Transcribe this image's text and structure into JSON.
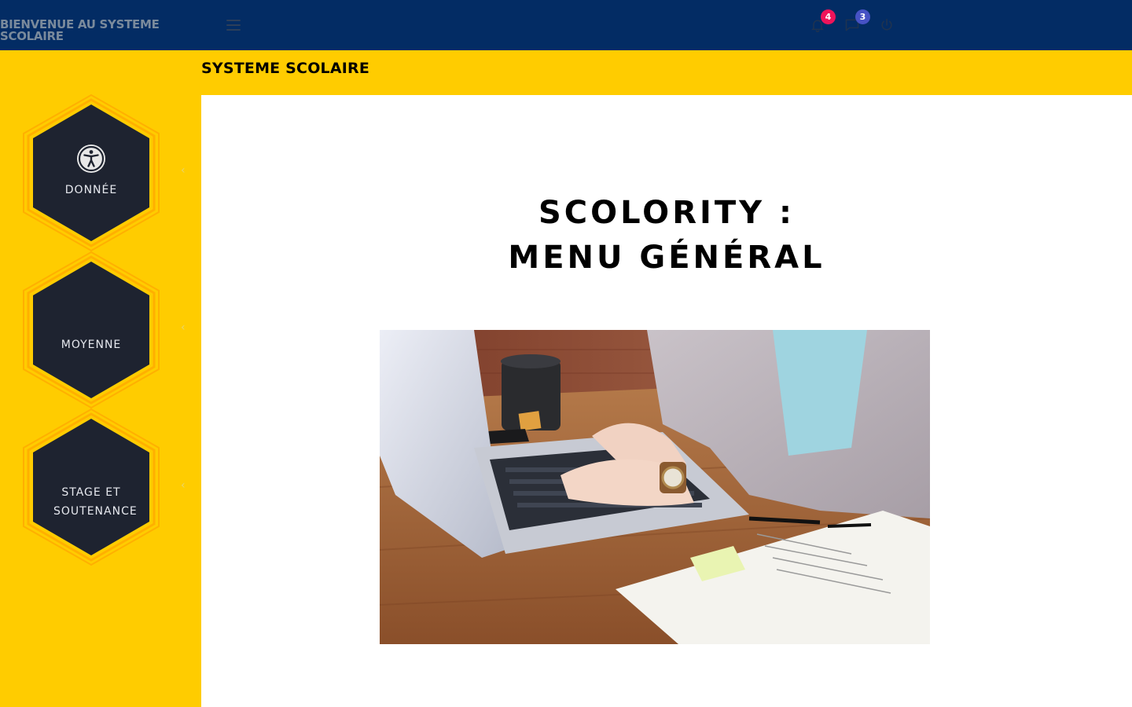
{
  "header": {
    "brand": "BIENVENUE AU SYSTEME SCOLAIRE",
    "notifications_count": "4",
    "messages_count": "3",
    "icons": [
      "hamburger-menu-icon",
      "bell-icon",
      "chat-icon",
      "power-icon"
    ]
  },
  "sidebar": {
    "items": [
      {
        "label": "DONNÉE",
        "icon": "accessibility-icon"
      },
      {
        "label": "MOYENNE"
      },
      {
        "label": "STAGE ET SOUTENANCE"
      }
    ],
    "chevron": "‹"
  },
  "page": {
    "section_title": "SYSTEME SCOLAIRE",
    "heading_line1": "SCOLORITY :",
    "heading_line2": "MENU GÉNÉRAL"
  },
  "colors": {
    "navbar": "#032c64",
    "accent_yellow": "#ffcc00",
    "hex_fill": "#1e2330",
    "hex_border": "#ffb000",
    "badge_red": "#f0145a",
    "badge_blue": "#4652c4"
  }
}
